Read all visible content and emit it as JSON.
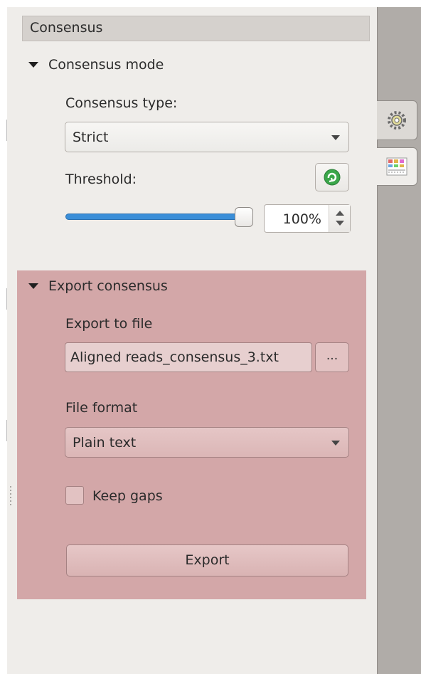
{
  "panel": {
    "header_title": "Consensus"
  },
  "consensus_mode": {
    "section_title": "Consensus mode",
    "type_label": "Consensus type:",
    "type_value": "Strict",
    "threshold_label": "Threshold:",
    "threshold_value": "100%",
    "threshold_level_percent": 100
  },
  "export": {
    "section_title": "Export consensus",
    "file_label": "Export to file",
    "file_value": "Aligned reads_consensus_3.txt",
    "browse_label": "...",
    "format_label": "File format",
    "format_value": "Plain text",
    "keep_gaps_label": "Keep gaps",
    "keep_gaps_checked": false,
    "export_button": "Export"
  },
  "side_tabs": [
    {
      "icon": "gear-icon"
    },
    {
      "icon": "table-icon"
    }
  ],
  "colors": {
    "panel_bg": "#efedea",
    "export_highlight": "#d3a7a8",
    "slider_fill": "#3a8ed8",
    "reset_icon": "#3aa64a"
  }
}
